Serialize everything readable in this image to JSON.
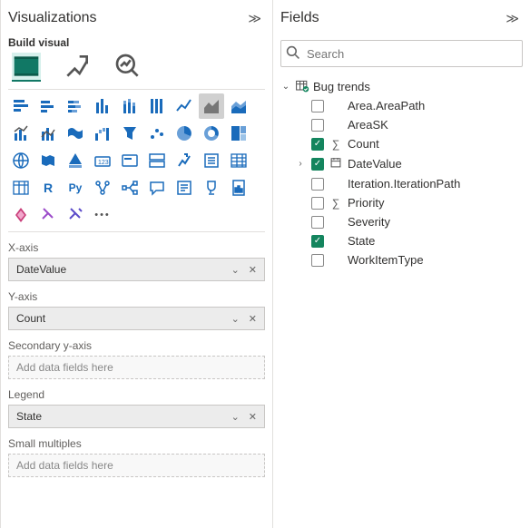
{
  "viz": {
    "title": "Visualizations",
    "subtitle": "Build visual",
    "wells": {
      "x": {
        "label": "X-axis",
        "value": "DateValue",
        "filled": true
      },
      "y": {
        "label": "Y-axis",
        "value": "Count",
        "filled": true
      },
      "y2": {
        "label": "Secondary y-axis",
        "value": "Add data fields here",
        "filled": false
      },
      "leg": {
        "label": "Legend",
        "value": "State",
        "filled": true
      },
      "sm": {
        "label": "Small multiples",
        "value": "Add data fields here",
        "filled": false
      }
    }
  },
  "fields": {
    "title": "Fields",
    "search_placeholder": "Search",
    "table": "Bug trends",
    "rows": [
      {
        "label": "Area.AreaPath",
        "checked": false,
        "icon": "",
        "expandable": false
      },
      {
        "label": "AreaSK",
        "checked": false,
        "icon": "",
        "expandable": false
      },
      {
        "label": "Count",
        "checked": true,
        "icon": "sigma",
        "expandable": false
      },
      {
        "label": "DateValue",
        "checked": true,
        "icon": "calendar",
        "expandable": true
      },
      {
        "label": "Iteration.IterationPath",
        "checked": false,
        "icon": "",
        "expandable": false
      },
      {
        "label": "Priority",
        "checked": false,
        "icon": "sigma",
        "expandable": false
      },
      {
        "label": "Severity",
        "checked": false,
        "icon": "",
        "expandable": false
      },
      {
        "label": "State",
        "checked": true,
        "icon": "",
        "expandable": false
      },
      {
        "label": "WorkItemType",
        "checked": false,
        "icon": "",
        "expandable": false
      }
    ]
  }
}
